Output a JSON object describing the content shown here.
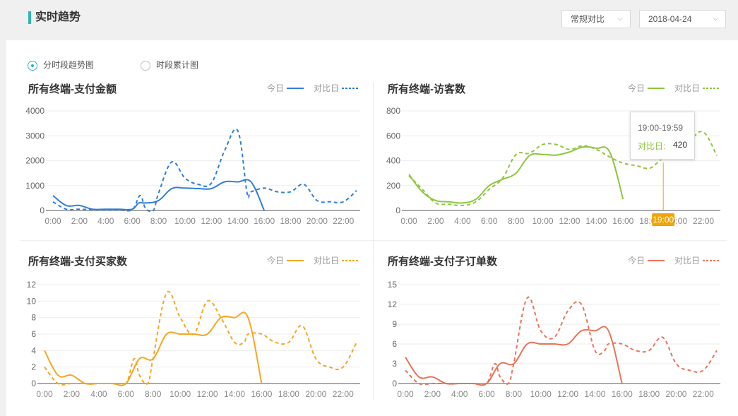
{
  "header": {
    "title": "实时趋势",
    "compare_select": "常规对比",
    "date_select": "2018-04-24",
    "accent": "#2db7b4"
  },
  "view_options": [
    {
      "label": "分时段趋势图",
      "selected": true
    },
    {
      "label": "时段累计图",
      "selected": false
    }
  ],
  "legend": {
    "today": "今日",
    "compare": "对比日"
  },
  "tooltip": {
    "time": "19:00-19:59",
    "label": "对比日:",
    "value": "420",
    "marker": "19:00"
  },
  "chart_data": [
    {
      "type": "line",
      "title": "所有终端-支付金额",
      "color": "#2f7ed8",
      "ylim": [
        0,
        4000
      ],
      "yticks": [
        0,
        1000,
        2000,
        3000,
        4000
      ],
      "xticks": [
        "0:00",
        "2:00",
        "4:00",
        "6:00",
        "8:00",
        "10:00",
        "12:00",
        "14:00",
        "16:00",
        "18:00",
        "20:00",
        "22:00"
      ],
      "series": [
        {
          "name": "今日",
          "dashed": false,
          "x": [
            0,
            1,
            2,
            3,
            4,
            5,
            6,
            6.5,
            7,
            8,
            9,
            10,
            11,
            12,
            13,
            14,
            15,
            16
          ],
          "y": [
            600,
            200,
            200,
            50,
            50,
            50,
            50,
            300,
            300,
            400,
            880,
            900,
            880,
            880,
            1150,
            1150,
            1150,
            0
          ]
        },
        {
          "name": "对比日",
          "dashed": true,
          "x": [
            0,
            1,
            2,
            3,
            4,
            5,
            6,
            6.6,
            7,
            7.6,
            8,
            9,
            10,
            11,
            12,
            13,
            14,
            14.7,
            15,
            16,
            17,
            18,
            19,
            20,
            21,
            22,
            23
          ],
          "y": [
            350,
            50,
            50,
            30,
            30,
            30,
            30,
            600,
            100,
            0,
            700,
            1950,
            1300,
            1050,
            1100,
            2400,
            3200,
            700,
            750,
            900,
            750,
            750,
            1050,
            400,
            350,
            350,
            800
          ]
        }
      ]
    },
    {
      "type": "line",
      "title": "所有终端-访客数",
      "color": "#8cc63f",
      "ylim": [
        0,
        800
      ],
      "yticks": [
        0,
        200,
        400,
        600,
        800
      ],
      "xticks": [
        "0:00",
        "2:00",
        "4:00",
        "6:00",
        "8:00",
        "10:00",
        "12:00",
        "14:00",
        "16:00",
        "18:00",
        "20:00",
        "22:00"
      ],
      "series": [
        {
          "name": "今日",
          "dashed": false,
          "x": [
            0,
            1,
            2,
            3,
            4,
            5,
            6,
            7,
            8,
            9,
            10,
            11,
            12,
            13,
            14,
            15,
            16
          ],
          "y": [
            290,
            150,
            80,
            70,
            60,
            90,
            200,
            250,
            300,
            440,
            450,
            445,
            470,
            510,
            500,
            470,
            90
          ]
        },
        {
          "name": "对比日",
          "dashed": true,
          "x": [
            0,
            1,
            2,
            3,
            4,
            5,
            6,
            7,
            8,
            9,
            10,
            11,
            12,
            13,
            14,
            15,
            16,
            17,
            18,
            19,
            20,
            21,
            22,
            23
          ],
          "y": [
            280,
            170,
            60,
            50,
            40,
            70,
            170,
            260,
            450,
            460,
            530,
            530,
            490,
            520,
            490,
            430,
            380,
            360,
            340,
            420,
            430,
            560,
            630,
            440
          ]
        }
      ]
    },
    {
      "type": "line",
      "title": "所有终端-支付买家数",
      "color": "#f5a623",
      "ylim": [
        0,
        12
      ],
      "yticks": [
        0,
        2,
        4,
        6,
        8,
        10,
        12
      ],
      "xticks": [
        "0:00",
        "2:00",
        "4:00",
        "6:00",
        "8:00",
        "10:00",
        "12:00",
        "14:00",
        "16:00",
        "18:00",
        "20:00",
        "22:00"
      ],
      "series": [
        {
          "name": "今日",
          "dashed": false,
          "x": [
            0,
            1,
            2,
            3,
            4,
            5,
            6,
            7,
            8,
            9,
            10,
            11,
            12,
            13,
            14,
            15,
            16
          ],
          "y": [
            4,
            1,
            1,
            0,
            0,
            0,
            0,
            3,
            3,
            6,
            6,
            6,
            6,
            8,
            8,
            8,
            0
          ]
        },
        {
          "name": "对比日",
          "dashed": true,
          "x": [
            0,
            1,
            2,
            3,
            4,
            5,
            6,
            6.6,
            7,
            7.6,
            8,
            9,
            10,
            11,
            12,
            13,
            14,
            14.7,
            15,
            16,
            17,
            18,
            19,
            20,
            21,
            22,
            23
          ],
          "y": [
            2,
            0,
            0,
            0,
            0,
            0,
            0,
            3,
            1,
            0,
            3,
            11,
            8,
            6,
            10,
            8,
            5,
            5,
            6,
            6,
            5,
            5,
            7,
            3,
            2,
            2,
            5
          ]
        }
      ]
    },
    {
      "type": "line",
      "title": "所有终端-支付子订单数",
      "color": "#e8735a",
      "ylim": [
        0,
        15
      ],
      "yticks": [
        0,
        3,
        6,
        9,
        12,
        15
      ],
      "xticks": [
        "0:00",
        "2:00",
        "4:00",
        "6:00",
        "8:00",
        "10:00",
        "12:00",
        "14:00",
        "16:00",
        "18:00",
        "20:00",
        "22:00"
      ],
      "series": [
        {
          "name": "今日",
          "dashed": false,
          "x": [
            0,
            1,
            2,
            3,
            4,
            5,
            6,
            7,
            8,
            9,
            10,
            11,
            12,
            13,
            14,
            15,
            16
          ],
          "y": [
            4,
            1,
            1,
            0,
            0,
            0,
            0,
            3,
            3,
            6,
            6,
            6,
            6,
            8,
            8,
            8,
            0
          ]
        },
        {
          "name": "对比日",
          "dashed": true,
          "x": [
            0,
            1,
            2,
            3,
            4,
            5,
            6,
            6.6,
            7,
            7.6,
            8,
            9,
            10,
            11,
            12,
            13,
            14,
            14.7,
            15,
            16,
            17,
            18,
            19,
            20,
            21,
            22,
            23
          ],
          "y": [
            2,
            0,
            0,
            0,
            0,
            0,
            0,
            3,
            1,
            0,
            3,
            13,
            8,
            7,
            11,
            12,
            5,
            5,
            6,
            6,
            5,
            5,
            7,
            3,
            2,
            2,
            5
          ]
        }
      ]
    }
  ]
}
